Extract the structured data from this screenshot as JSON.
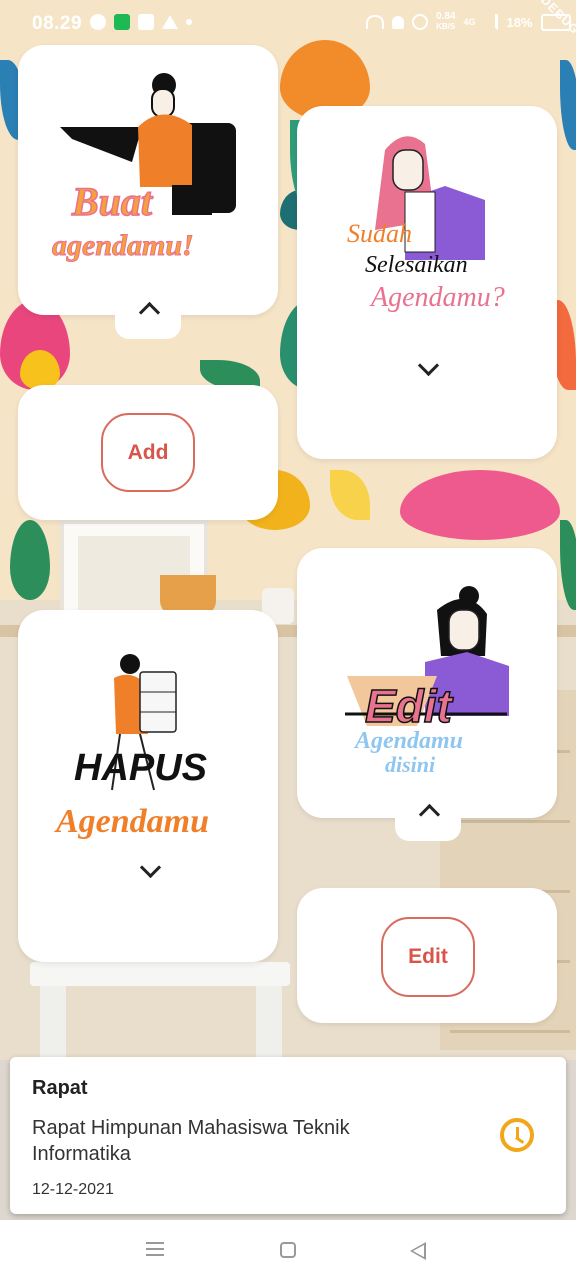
{
  "status_bar": {
    "time": "08.29",
    "net_speed_value": "0.84",
    "net_speed_unit": "KB/S",
    "network": "4G",
    "battery": "18%",
    "debug_banner": "DEBUG"
  },
  "cards": {
    "buat": {
      "title_line1": "Buat",
      "title_line2": "agendamu!"
    },
    "selesai": {
      "title_line1": "Sudah",
      "title_line2": "Selesaikan",
      "title_line3": "Agendamu?"
    },
    "add": {
      "button_label": "Add"
    },
    "hapus": {
      "title_line1": "HAPUS",
      "title_line2": "Agendamu"
    },
    "edit_art": {
      "title_line1": "Edit",
      "title_line2": "Agendamu",
      "title_line3": "disini"
    },
    "edit": {
      "button_label": "Edit"
    }
  },
  "agenda_item": {
    "title": "Rapat",
    "description": "Rapat Himpunan Mahasiswa Teknik Informatika",
    "date": "12-12-2021"
  },
  "colors": {
    "button_text": "#d9544a",
    "clock_accent": "#f2a619",
    "orange": "#f07f2a",
    "pink": "#e8728f",
    "purple": "#8b5bd6"
  },
  "icons": [
    "chevron-up-icon",
    "chevron-down-icon",
    "clock-icon",
    "nav-menu-icon",
    "nav-home-icon",
    "nav-back-icon"
  ]
}
